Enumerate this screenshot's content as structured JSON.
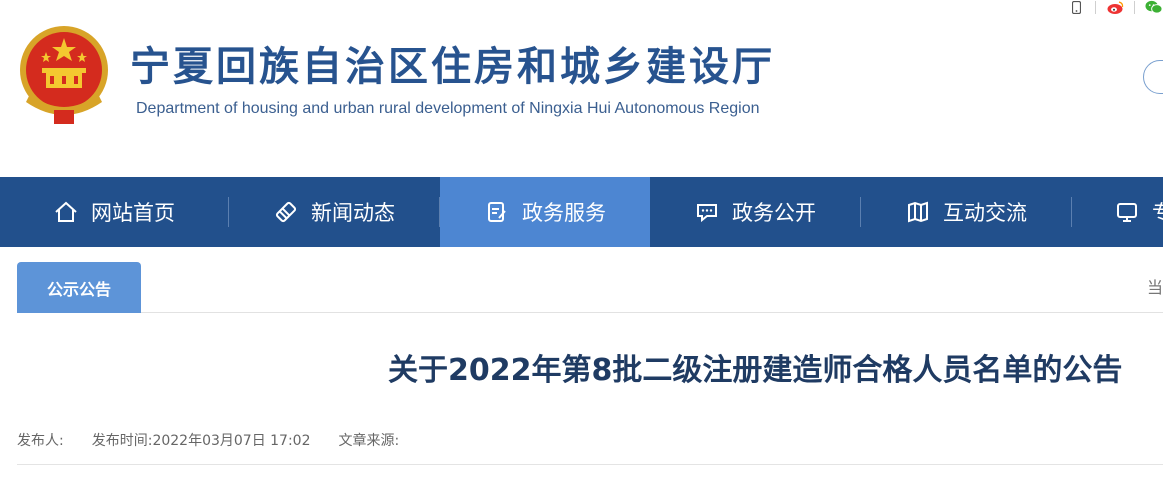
{
  "header": {
    "title_cn": "宁夏回族自治区住房和城乡建设厅",
    "title_en": "Department of housing and urban rural development of Ningxia Hui Autonomous Region",
    "util_icons": [
      "mobile-icon",
      "weibo-icon",
      "wechat-icon"
    ]
  },
  "nav": {
    "items": [
      {
        "label": "网站首页",
        "icon": "home-icon",
        "active": false
      },
      {
        "label": "新闻动态",
        "icon": "news-icon",
        "active": false
      },
      {
        "label": "政务服务",
        "icon": "service-icon",
        "active": true
      },
      {
        "label": "政务公开",
        "icon": "message-icon",
        "active": false
      },
      {
        "label": "互动交流",
        "icon": "map-icon",
        "active": false
      },
      {
        "label": "专",
        "icon": "monitor-icon",
        "active": false
      }
    ]
  },
  "tabs": {
    "active_label": "公示公告",
    "location_partial": "当"
  },
  "article": {
    "title": "关于2022年第8批二级注册建造师合格人员名单的公告",
    "publisher_label": "发布人:",
    "time_label": "发布时间:",
    "time_value": "2022年03月07日 17:02",
    "source_label": "文章来源:"
  },
  "colors": {
    "nav_bg": "#22508c",
    "nav_active": "#4d86d2",
    "tab_bg": "#5d94d8",
    "title_color": "#27538f"
  }
}
